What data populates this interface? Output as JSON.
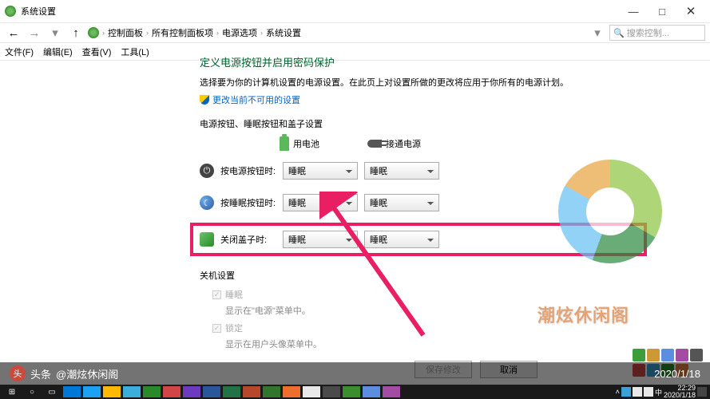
{
  "window": {
    "title": "系统设置",
    "minimize": "—",
    "maximize": "□",
    "close": "✕"
  },
  "breadcrumb": {
    "items": [
      "控制面板",
      "所有控制面板项",
      "电源选项",
      "系统设置"
    ],
    "sep": "›"
  },
  "search": {
    "placeholder": "搜索控制..."
  },
  "menubar": {
    "items": [
      "文件(F)",
      "编辑(E)",
      "查看(V)",
      "工具(L)"
    ]
  },
  "main": {
    "heading": "定义电源按钮并启用密码保护",
    "desc": "选择要为你的计算机设置的电源设置。在此页上对设置所做的更改将应用于你所有的电源计划。",
    "link": "更改当前不可用的设置",
    "section1": "电源按钮、睡眠按钮和盖子设置",
    "col_battery": "用电池",
    "col_plugged": "接通电源",
    "rows": [
      {
        "label": "按电源按钮时:",
        "battery": "睡眠",
        "plugged": "睡眠"
      },
      {
        "label": "按睡眠按钮时:",
        "battery": "睡眠",
        "plugged": "睡眠"
      },
      {
        "label": "关闭盖子时:",
        "battery": "睡眠",
        "plugged": "睡眠"
      }
    ],
    "section2": "关机设置",
    "shutdown": [
      {
        "label": "睡眠",
        "sub": "显示在\"电源\"菜单中。"
      },
      {
        "label": "锁定",
        "sub": "显示在用户头像菜单中。"
      }
    ],
    "save": "保存修改",
    "cancel": "取消"
  },
  "caption": {
    "source": "头条",
    "author": "@潮炫休闲阁",
    "date": "2020/1/18"
  },
  "watermark": "潮炫休闲阁",
  "taskbar": {
    "time": "22:29",
    "date": "2020/1/18"
  }
}
